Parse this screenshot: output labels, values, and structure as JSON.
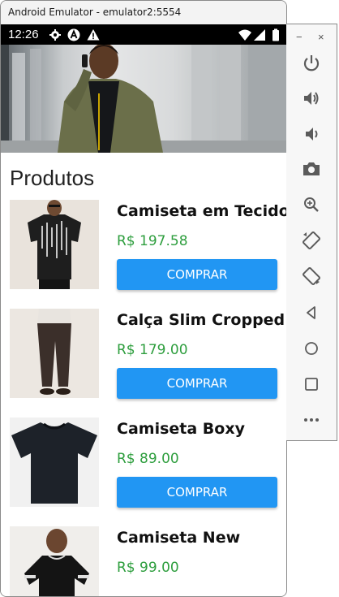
{
  "window": {
    "title": "Android Emulator - emulator2:5554",
    "minimize_label": "−",
    "close_label": "×"
  },
  "statusbar": {
    "time": "12:26",
    "icons": [
      "gear-icon",
      "a-logo-icon",
      "alert-icon",
      "wifi-icon",
      "signal-icon",
      "battery-icon"
    ]
  },
  "page": {
    "title": "Produtos"
  },
  "products": [
    {
      "name": "Camiseta em Tecido",
      "price": "R$ 197.58",
      "button": "COMPRAR"
    },
    {
      "name": "Calça Slim Cropped",
      "price": "R$ 179.00",
      "button": "COMPRAR"
    },
    {
      "name": "Camiseta Boxy",
      "price": "R$ 89.00",
      "button": "COMPRAR"
    },
    {
      "name": "Camiseta New",
      "price": "R$ 99.00",
      "button": "COMPRAR"
    }
  ],
  "side_toolbar": [
    "power-icon",
    "volume-up-icon",
    "volume-down-icon",
    "camera-icon",
    "zoom-icon",
    "rotate-left-icon",
    "rotate-right-icon",
    "back-icon",
    "home-icon",
    "overview-icon",
    "more-icon"
  ],
  "colors": {
    "accent": "#2196f3",
    "price": "#2e9e3e",
    "statusbar": "#000000"
  }
}
